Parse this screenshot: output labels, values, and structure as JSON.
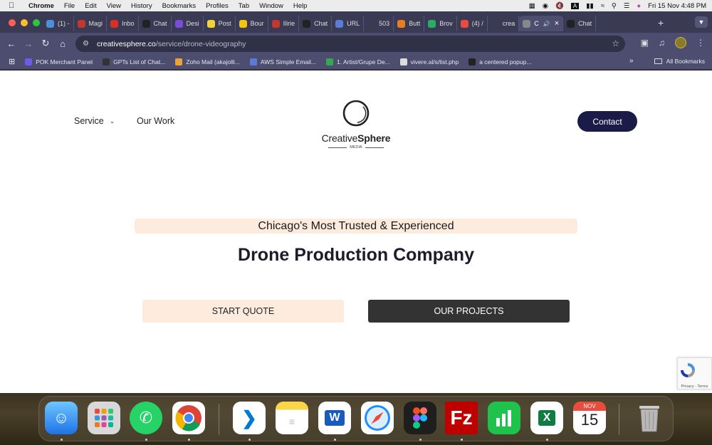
{
  "menubar": {
    "app_name": "Chrome",
    "items": [
      "File",
      "Edit",
      "View",
      "History",
      "Bookmarks",
      "Profiles",
      "Tab",
      "Window",
      "Help"
    ],
    "clock": "Fri 15 Nov  4:48 PM"
  },
  "tabs": [
    {
      "label": "(1) -",
      "color": "#4a90d9"
    },
    {
      "label": "Magi",
      "color": "#c0392b"
    },
    {
      "label": "Inbo",
      "color": "#d93025"
    },
    {
      "label": "Chat",
      "color": "#222222"
    },
    {
      "label": "Desi",
      "color": "#7b4bd9"
    },
    {
      "label": "Post",
      "color": "#f4d03f"
    },
    {
      "label": "Bour",
      "color": "#f1c40f"
    },
    {
      "label": "Ilirie",
      "color": "#c0392b"
    },
    {
      "label": "Chat",
      "color": "#222222"
    },
    {
      "label": "URL",
      "color": "#5b7bd9"
    },
    {
      "label": "503",
      "color": "#3a3a55"
    },
    {
      "label": "Butt",
      "color": "#e67e22"
    },
    {
      "label": "Brov",
      "color": "#27ae60"
    },
    {
      "label": "(4) /",
      "color": "#e74c3c"
    },
    {
      "label": "crea",
      "color": "#3a3a55"
    },
    {
      "label": "C",
      "color": "#888888",
      "active": true
    },
    {
      "label": "Chat",
      "color": "#222222"
    }
  ],
  "toolbar": {
    "url_host": "creativesphere.co",
    "url_path": "/service/drone-videography"
  },
  "bookmarks": [
    {
      "label": "POK Merchant Panel",
      "color": "#6c5ce7"
    },
    {
      "label": "GPTs List of Chat...",
      "color": "#333333"
    },
    {
      "label": "Zoho Mail (akajolli...",
      "color": "#e8a33a"
    },
    {
      "label": "AWS Simple Email...",
      "color": "#5b7bd9"
    },
    {
      "label": "1. Artist/Grupe De...",
      "color": "#34a853"
    },
    {
      "label": "vivere.al/s/list.php",
      "color": "#dddddd"
    },
    {
      "label": "a centered popup...",
      "color": "#222222"
    }
  ],
  "bookmarks_all": "All Bookmarks",
  "site": {
    "nav_service": "Service",
    "nav_work": "Our Work",
    "logo_light": "Creative",
    "logo_bold": "Sphere",
    "logo_sub": "MEDIA",
    "contact": "Contact",
    "tagline": "Chicago's Most Trusted & Experienced",
    "headline": "Drone Production Company",
    "btn_quote": "START QUOTE",
    "btn_projects": "OUR PROJECTS",
    "recaptcha_text": "Privacy - Terms"
  },
  "dock": {
    "calendar_month": "NOV",
    "calendar_day": "15"
  },
  "colors": {
    "accent_navy": "#1b1b48",
    "peach": "#fdebdd",
    "dark_button": "#333333"
  }
}
